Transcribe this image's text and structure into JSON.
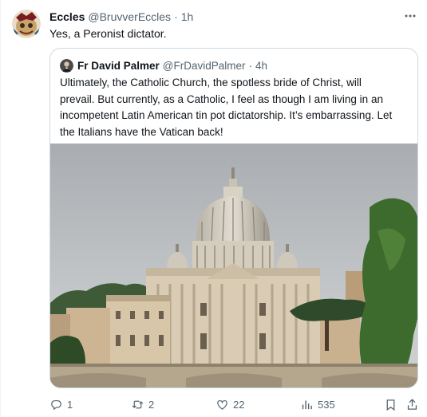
{
  "post": {
    "author_name": "Eccles",
    "author_handle": "@BruvverEccles",
    "separator": "·",
    "time": "1h",
    "text": "Yes, a Peronist dictator.",
    "avatar_icon": "user-avatar-icon",
    "more_icon": "more-horizontal-icon"
  },
  "quoted_post": {
    "author_name": "Fr David Palmer",
    "author_handle": "@FrDavidPalmer",
    "separator": "·",
    "time": "4h",
    "text_lines": [
      "Ultimately, the Catholic Church, the spotless bride of Christ, will",
      "prevail. But currently, as a Catholic, I feel as though I am living in an",
      "incompetent Latin American tin pot dictatorship. It’s embarrassing. Let",
      "the Italians have the Vatican back!"
    ],
    "image_subject": "st-peters-basilica-photo"
  },
  "actions": {
    "reply": {
      "icon": "reply-icon",
      "count": "1"
    },
    "repost": {
      "icon": "repost-icon",
      "count": "2"
    },
    "like": {
      "icon": "heart-icon",
      "count": "22"
    },
    "views": {
      "icon": "views-chart-icon",
      "count": "535"
    },
    "bookmark": {
      "icon": "bookmark-icon"
    },
    "share": {
      "icon": "share-icon"
    }
  },
  "colors": {
    "text_primary": "#0f1419",
    "text_secondary": "#536471",
    "border": "#cfd9de"
  }
}
